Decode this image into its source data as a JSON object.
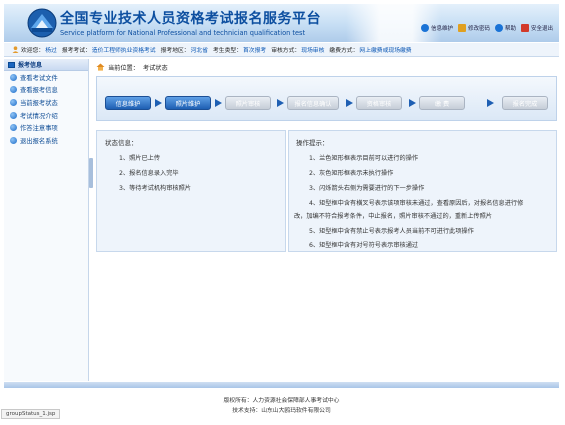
{
  "header": {
    "title": "全国专业技术人员资格考试报名服务平台",
    "subtitle": "Service platform for National Professional and technician qualification test",
    "actions": [
      {
        "label": "信息维护",
        "icon": "info-icon",
        "color": "#1a73d6"
      },
      {
        "label": "修改密码",
        "icon": "key-icon",
        "color": "#e0a020"
      },
      {
        "label": "帮助",
        "icon": "help-icon",
        "color": "#1a73d6"
      },
      {
        "label": "安全退出",
        "icon": "exit-icon",
        "color": "#d23a2a"
      }
    ]
  },
  "info_bar": {
    "welcome_label": "欢迎您：",
    "welcome_value": "杨过",
    "exam_label": "报考考试：",
    "exam_value": "造价工程师执业资格考试",
    "region_label": "报考地区：",
    "region_value": "河北省",
    "type_label": "考生类型：",
    "type_value": "首次报考",
    "review_label": "审核方式：",
    "review_value": "现场审核",
    "pay_label": "缴费方式：",
    "pay_value": "网上缴费或现场缴费"
  },
  "sidebar": {
    "title": "报考信息",
    "items": [
      {
        "label": "查看考试文件"
      },
      {
        "label": "查看报考信息"
      },
      {
        "label": "当前报考状态"
      },
      {
        "label": "考试情况介绍"
      },
      {
        "label": "作答注意事项"
      },
      {
        "label": "退出报名系统"
      }
    ]
  },
  "breadcrumb": {
    "label": "当前位置：",
    "value": "考试状态"
  },
  "steps": [
    {
      "label": "信息维护",
      "done": true
    },
    {
      "label": "照片维护",
      "done": true
    },
    {
      "label": "照片审核",
      "done": false
    },
    {
      "label": "报名信息确认",
      "done": false
    },
    {
      "label": "资格审核",
      "done": false
    },
    {
      "label": "缴  费",
      "done": false
    },
    {
      "label": "报名完成",
      "done": false
    }
  ],
  "status_panel": {
    "title": "状态信息：",
    "lines": [
      "1、照片已上传",
      "2、报名信息录入完毕",
      "3、等待考试机构审核照片"
    ]
  },
  "tips_panel": {
    "title": "操作提示：",
    "lines": [
      "1、兰色矩形框表示目前可以进行的操作",
      "2、灰色矩形框表示未执行操作",
      "3、闪烁箭头右侧为需要进行的下一步操作",
      "4、矩型框中含有横叉号表示该项审核未通过，查看原因后，对报名信息进行修",
      "改，加编不符合报考条件，中止报名，照片审核不通过的，重新上传照片",
      "5、矩型框中含有禁止号表示报考人员当前不可进行此项操作",
      "6、矩型框中含有对号符号表示审核通过"
    ]
  },
  "footer": {
    "copyright": "版权所有：人力资源社会保障部人事考试中心",
    "support": "技术支持：山东山大鸥玛软件有限公司"
  },
  "status_tab": "groupStatus_1.jsp"
}
